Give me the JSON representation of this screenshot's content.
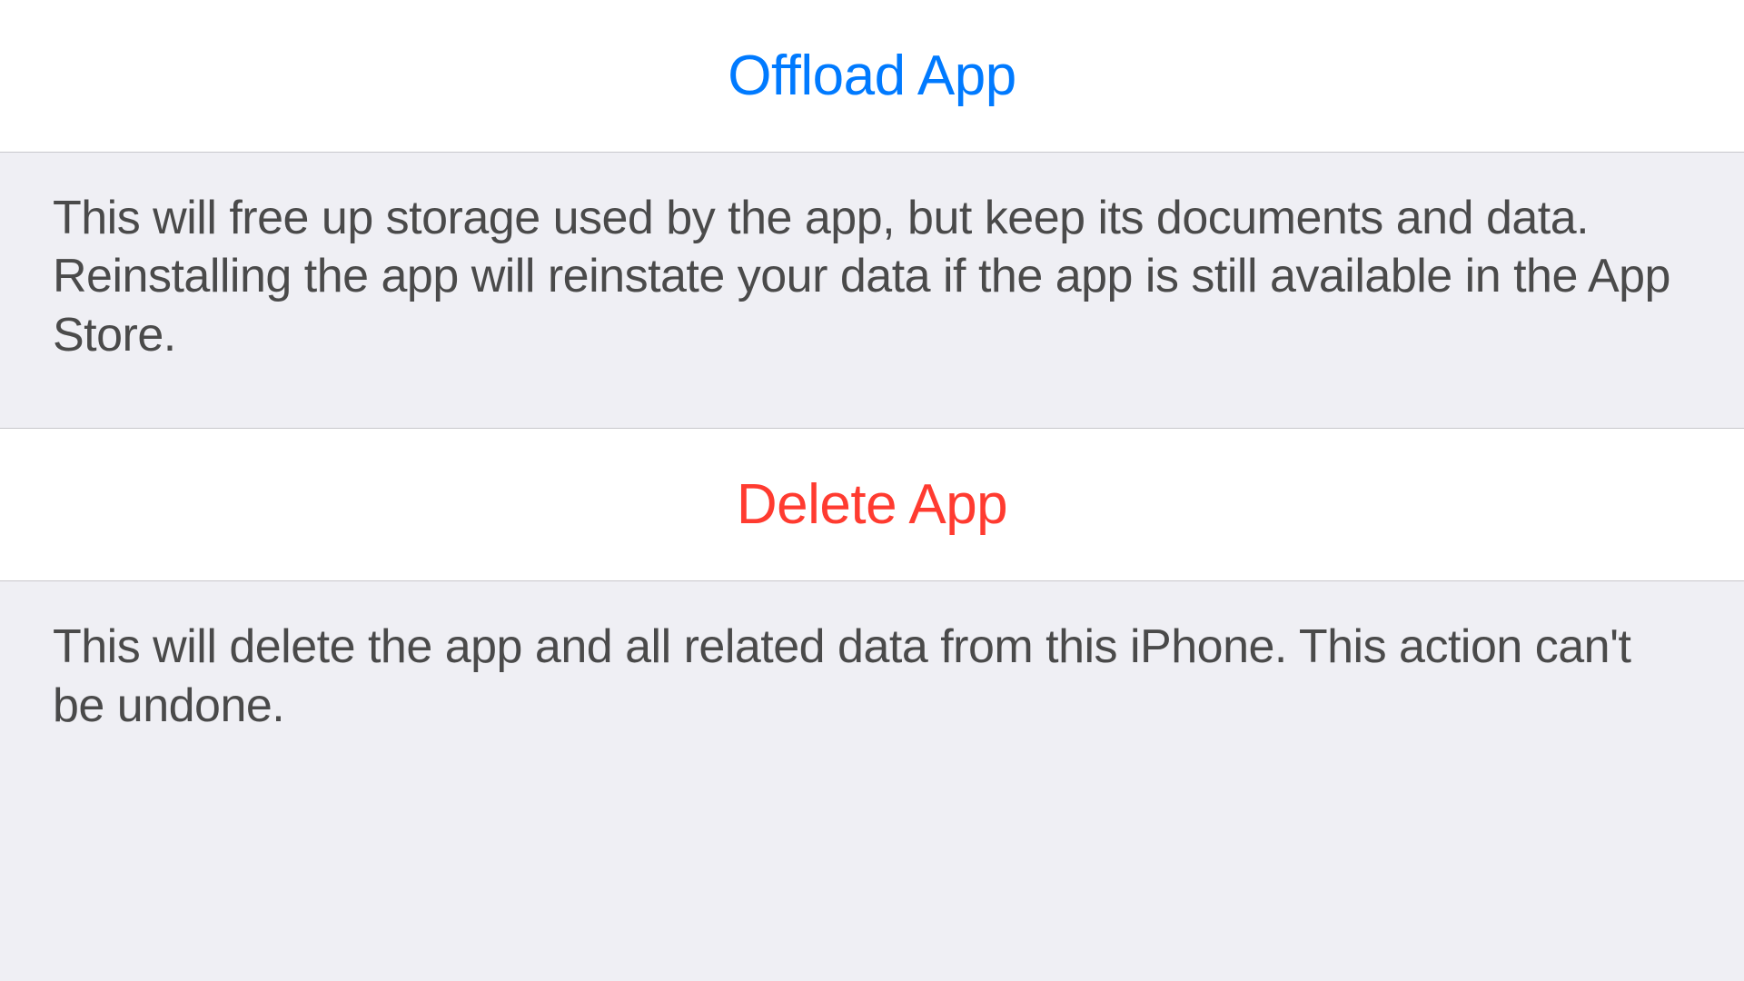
{
  "actions": {
    "offload": {
      "label": "Offload App",
      "description": "This will free up storage used by the app, but keep its documents and data. Reinstalling the app will reinstate your data if the app is still available in the App Store."
    },
    "delete": {
      "label": "Delete App",
      "description": "This will delete the app and all related data from this iPhone. This action can't be undone."
    }
  },
  "colors": {
    "primary": "#007aff",
    "destructive": "#ff3b30",
    "background": "#efeff4",
    "cellBackground": "#ffffff",
    "separator": "#c8c7cc",
    "descriptionText": "#4a4a4a"
  }
}
